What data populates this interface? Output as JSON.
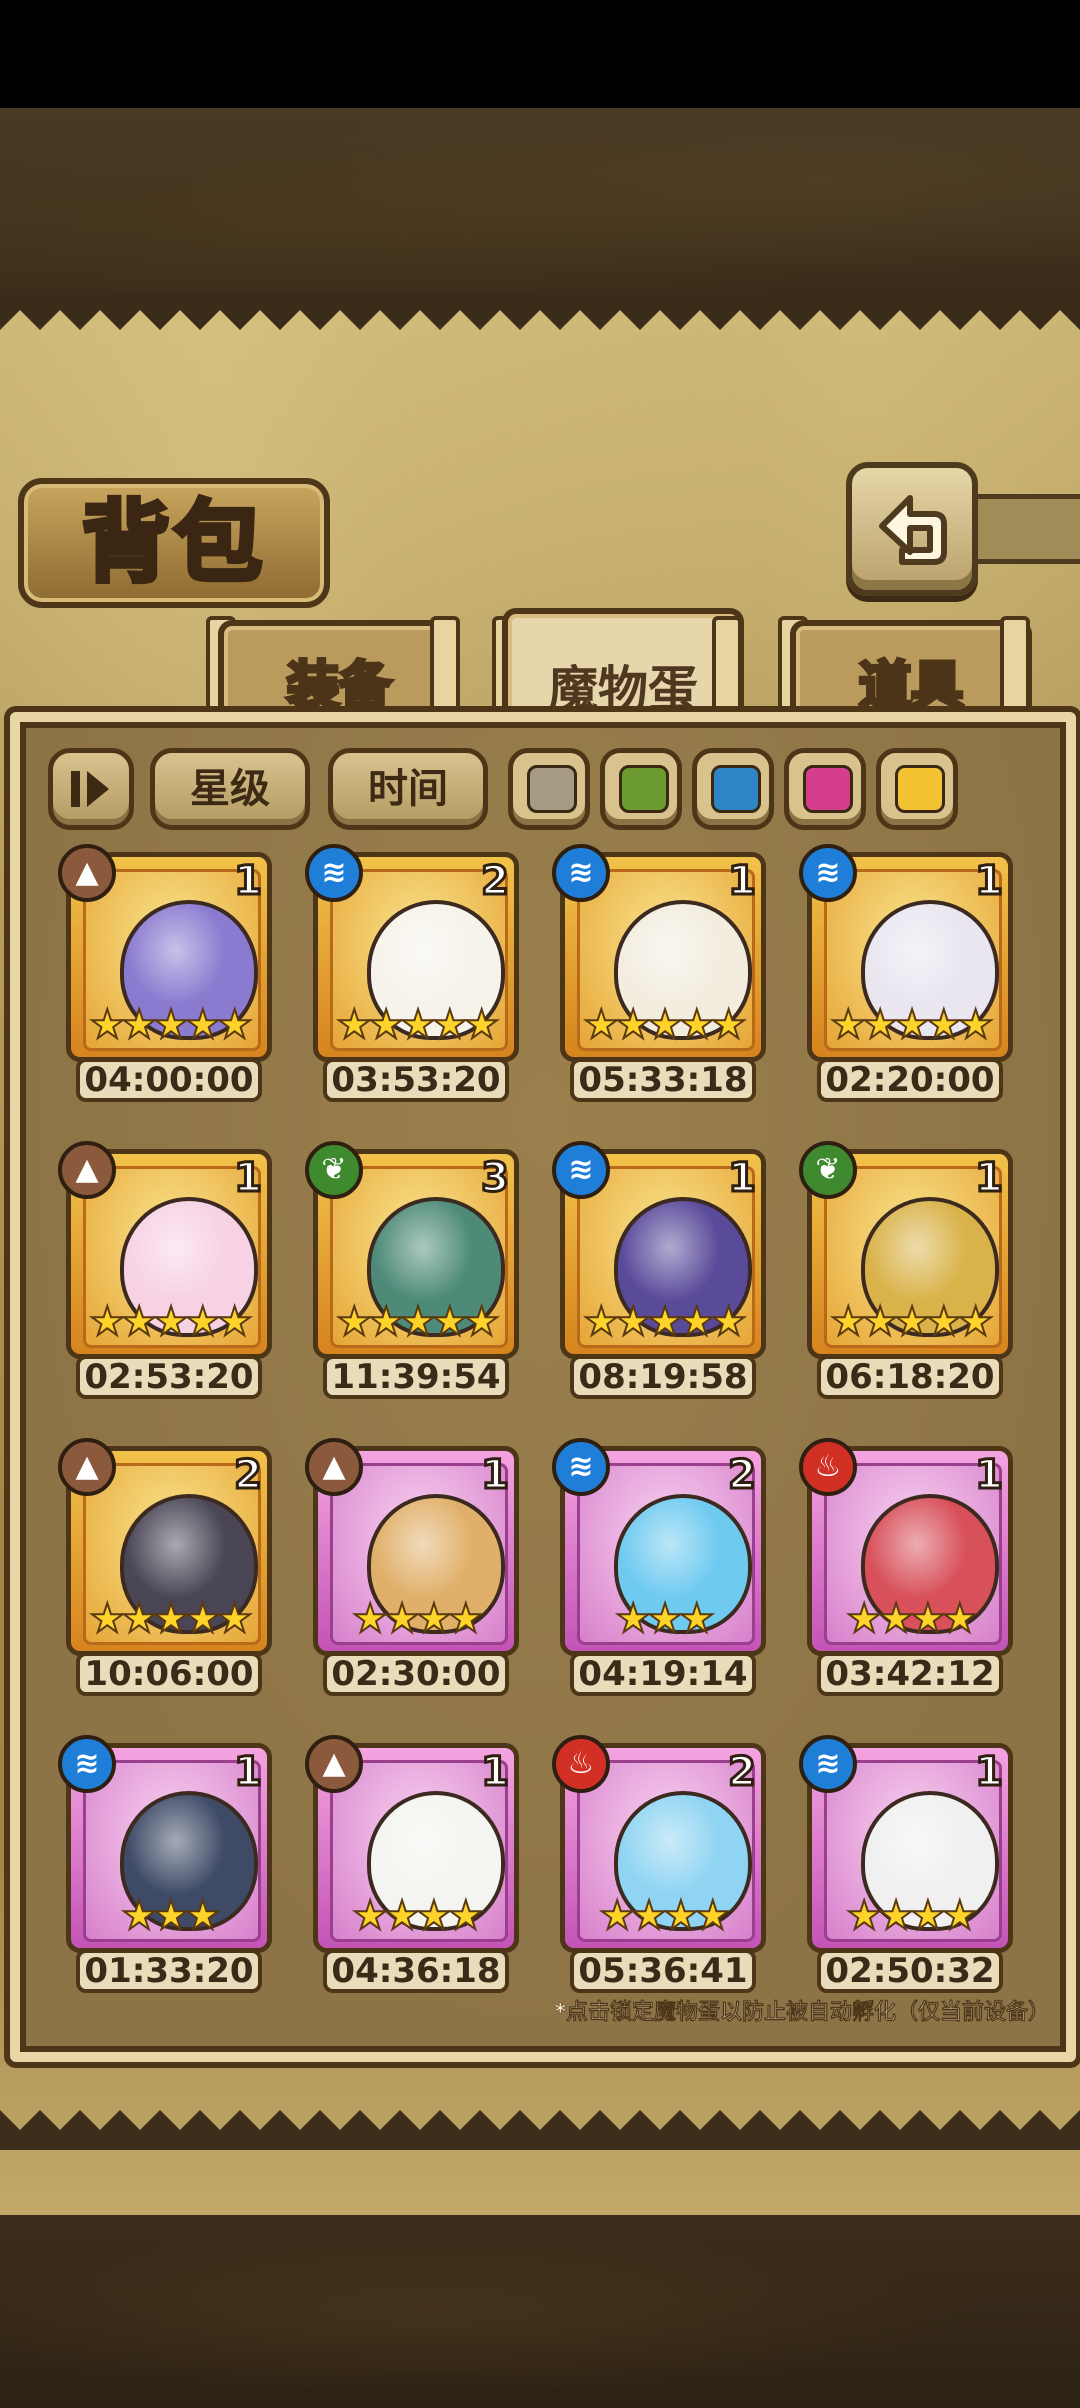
{
  "header": {
    "title": "背包"
  },
  "tabs": [
    {
      "label": "装备",
      "active": false
    },
    {
      "label": "魔物蛋",
      "active": true
    },
    {
      "label": "道具",
      "active": false
    }
  ],
  "filters": {
    "sort_icon": "sort-toggle-icon",
    "star_label": "星级",
    "time_label": "时间",
    "colors": [
      "#a59a82",
      "#6b9a2e",
      "#2f86c7",
      "#d43e8c",
      "#f2c232"
    ]
  },
  "element_colors": {
    "earth": "#8b5a3c",
    "water": "#1e7ed8",
    "nature": "#3f8a2e",
    "fire": "#d23024"
  },
  "eggs": [
    {
      "element": "earth",
      "count": "1",
      "stars": "★★★★★",
      "time": "04:00:00",
      "rarity": "gold",
      "egg_color": "#8a7ad0"
    },
    {
      "element": "water",
      "count": "2",
      "stars": "★★★★★",
      "time": "03:53:20",
      "rarity": "gold",
      "egg_color": "#f6f3ea"
    },
    {
      "element": "water",
      "count": "1",
      "stars": "★★★★★",
      "time": "05:33:18",
      "rarity": "gold",
      "egg_color": "#f3ede0"
    },
    {
      "element": "water",
      "count": "1",
      "stars": "★★★★★",
      "time": "02:20:00",
      "rarity": "gold",
      "egg_color": "#e9e6f0"
    },
    {
      "element": "earth",
      "count": "1",
      "stars": "★★★★★",
      "time": "02:53:20",
      "rarity": "gold",
      "egg_color": "#f7d2e4"
    },
    {
      "element": "nature",
      "count": "3",
      "stars": "★★★★★",
      "time": "11:39:54",
      "rarity": "gold",
      "egg_color": "#4d8a78"
    },
    {
      "element": "water",
      "count": "1",
      "stars": "★★★★★",
      "time": "08:19:58",
      "rarity": "gold",
      "egg_color": "#5a4a9a"
    },
    {
      "element": "nature",
      "count": "1",
      "stars": "★★★★★",
      "time": "06:18:20",
      "rarity": "gold",
      "egg_color": "#d9b34a"
    },
    {
      "element": "earth",
      "count": "2",
      "stars": "★★★★★",
      "time": "10:06:00",
      "rarity": "gold",
      "egg_color": "#4a4656"
    },
    {
      "element": "earth",
      "count": "1",
      "stars": "★★★★",
      "time": "02:30:00",
      "rarity": "pink",
      "egg_color": "#e0b06a"
    },
    {
      "element": "water",
      "count": "2",
      "stars": "★★★",
      "time": "04:19:14",
      "rarity": "pink",
      "egg_color": "#6fcaf0"
    },
    {
      "element": "fire",
      "count": "1",
      "stars": "★★★★",
      "time": "03:42:12",
      "rarity": "pink",
      "egg_color": "#d8505a"
    },
    {
      "element": "water",
      "count": "1",
      "stars": "★★★",
      "time": "01:33:20",
      "rarity": "pink",
      "egg_color": "#3e4a66"
    },
    {
      "element": "earth",
      "count": "1",
      "stars": "★★★★",
      "time": "04:36:18",
      "rarity": "pink",
      "egg_color": "#f4f4f0"
    },
    {
      "element": "fire",
      "count": "2",
      "stars": "★★★★",
      "time": "05:36:41",
      "rarity": "pink",
      "egg_color": "#8fd4f2"
    },
    {
      "element": "water",
      "count": "1",
      "stars": "★★★★",
      "time": "02:50:32",
      "rarity": "pink",
      "egg_color": "#f0f0f0"
    }
  ],
  "footer_note": "*点击锁定魔物蛋以防止被自动孵化（仅当前设备）"
}
